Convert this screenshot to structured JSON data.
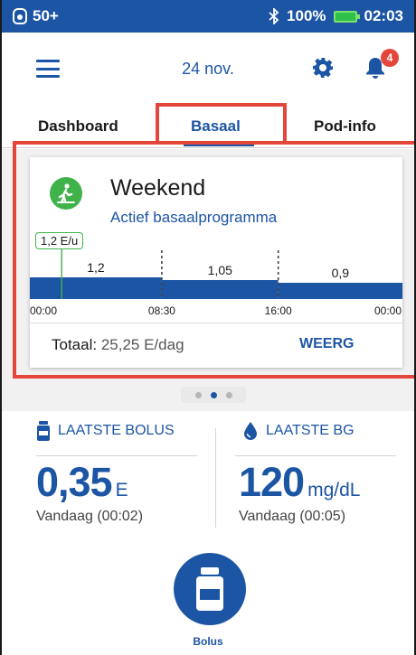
{
  "status_bar": {
    "pod_units": "50+",
    "battery_percent": "100%",
    "time": "02:03",
    "icons": [
      "pod-icon",
      "bluetooth-icon",
      "battery-icon"
    ],
    "battery_color": "#2ec04a"
  },
  "header": {
    "date": "24 nov.",
    "notification_count": "4",
    "icons": [
      "menu-icon",
      "gear-icon",
      "bell-icon"
    ]
  },
  "tabs": [
    {
      "label": "Dashboard",
      "active": false
    },
    {
      "label": "Basaal",
      "active": true
    },
    {
      "label": "Pod-info",
      "active": false
    }
  ],
  "basal_card": {
    "program_name": "Weekend",
    "program_status": "Actief basaalprogramma",
    "current_rate": "1,2 E/u",
    "icon": "walking-person-icon",
    "chart_data": {
      "type": "area",
      "segments": [
        {
          "start": "00:00",
          "end": "08:30",
          "rate": 1.2,
          "label": "1,2"
        },
        {
          "start": "08:30",
          "end": "16:00",
          "rate": 1.05,
          "label": "1,05"
        },
        {
          "start": "16:00",
          "end": "00:00",
          "rate": 0.9,
          "label": "0,9"
        }
      ],
      "x_ticks": [
        "00:00",
        "08:30",
        "16:00",
        "00:00"
      ],
      "current_time": "02:03"
    },
    "total_label": "Totaal:",
    "total_value": "25,25 E/dag",
    "view_label": "WEERG"
  },
  "pager": {
    "count": 3,
    "active_index": 1
  },
  "last_bolus": {
    "title": "LAATSTE BOLUS",
    "value": "0,35",
    "unit": "E",
    "timestamp": "Vandaag (00:02)",
    "icon": "insulin-vial-icon"
  },
  "last_bg": {
    "title": "LAATSTE BG",
    "value": "120",
    "unit": "mg/dL",
    "timestamp": "Vandaag (00:05)",
    "icon": "blood-drop-icon"
  },
  "bolus_button": {
    "label": "Bolus",
    "icon": "insulin-vial-icon"
  },
  "colors": {
    "primary_blue": "#1d55a5",
    "highlight_red": "#e4463c",
    "program_green": "#3fb34a"
  }
}
